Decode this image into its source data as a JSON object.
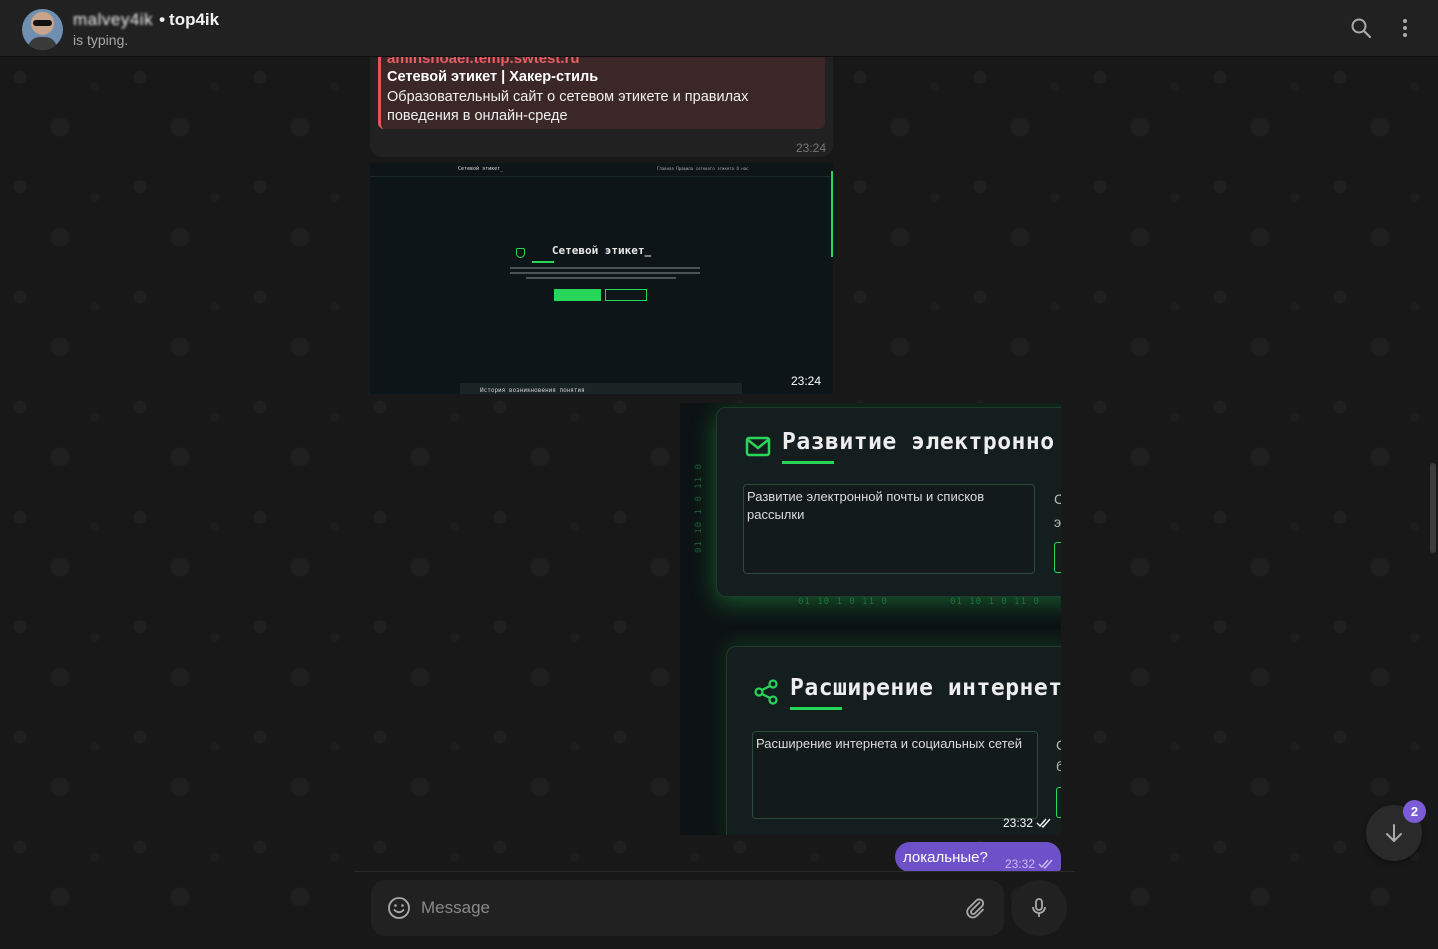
{
  "header": {
    "name_obscured": "malvey4ik",
    "separator": "•",
    "name": "top4ik",
    "status": "is typing."
  },
  "messages": {
    "link_preview": {
      "site": "aminshoaei.temp.swtest.ru",
      "title": "Сетевой этикет | Хакер-стиль",
      "description": "Образовательный сайт о сетевом этикете и правилах поведения в онлайн-среде",
      "time": "23:24"
    },
    "photo1": {
      "time": "23:24",
      "site_logo": "Сетевой этикет_",
      "nav_links": "Главная   Правила сетевого этикета   О нас",
      "hero_title": "Сетевой этикет_",
      "bottom_heading": "История возникновения понятия"
    },
    "photo2": {
      "time": "23:32",
      "card1": {
        "title": "Развитие электронно",
        "box_text": "Развитие электронной почты и списков рассылки",
        "side_letters": "С\nэ"
      },
      "card2": {
        "title": "Расширение интернет",
        "box_text": "Расширение интернета и социальных сетей",
        "side_letters": "С\nб"
      },
      "matrix_text": "01 10 1 0 11 0"
    },
    "outgoing": {
      "text": "локальные?",
      "time": "23:32"
    }
  },
  "composer": {
    "placeholder": "Message"
  },
  "scroll_down": {
    "unread_count": "2"
  },
  "colors": {
    "accent_green": "#28d65a",
    "outgoing_bubble": "#6e51c9",
    "link_accent": "#e0555a"
  }
}
